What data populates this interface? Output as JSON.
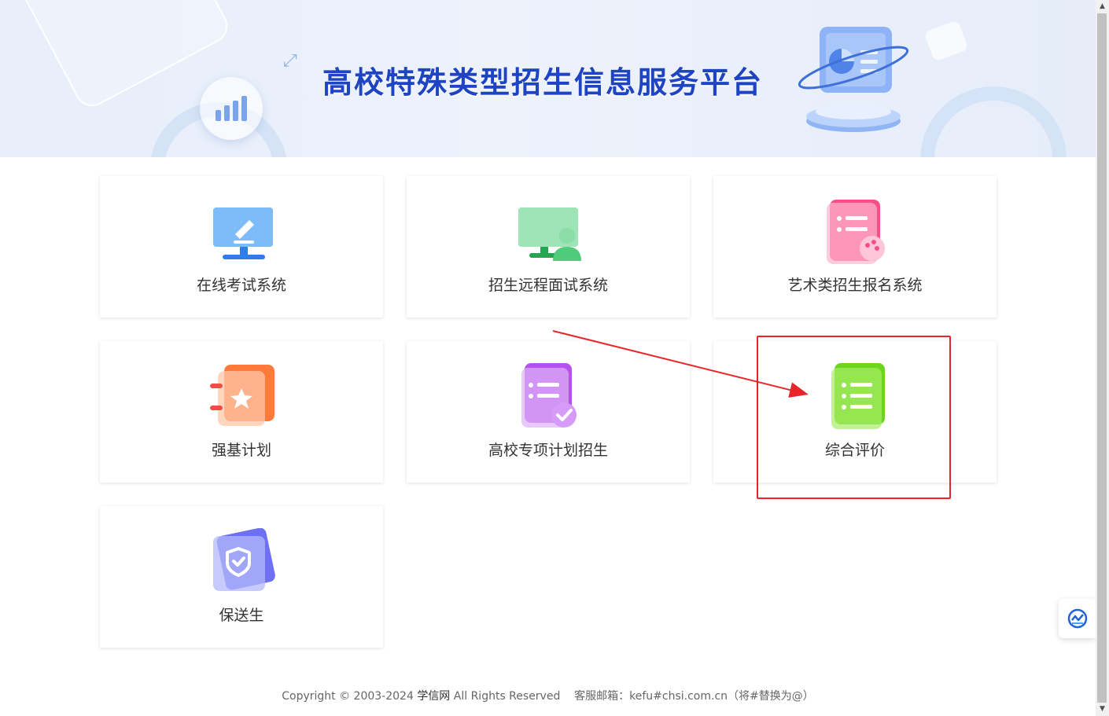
{
  "banner": {
    "title": "高校特殊类型招生信息服务平台",
    "title_color": "#1e44c4"
  },
  "cards": [
    {
      "label": "在线考试系统",
      "icon": "monitor-edit-icon",
      "color": "#4a9cf5"
    },
    {
      "label": "招生远程面试系统",
      "icon": "monitor-user-icon",
      "color": "#3dc46b"
    },
    {
      "label": "艺术类招生报名系统",
      "icon": "doc-palette-icon",
      "color": "#f7588d"
    },
    {
      "label": "强基计划",
      "icon": "notebook-star-icon",
      "color": "#fb7a3c"
    },
    {
      "label": "高校专项计划招生",
      "icon": "doc-check-icon",
      "color": "#b257ee"
    },
    {
      "label": "综合评价",
      "icon": "doc-list-icon",
      "color": "#6bd61c"
    },
    {
      "label": "保送生",
      "icon": "shield-check-icon",
      "color": "#6b73f3"
    }
  ],
  "annotation": {
    "highlight_color": "#e8262a",
    "target": "综合评价"
  },
  "footer": {
    "copyright_prefix": "Copyright © 2003-2024",
    "site_name": "学信网",
    "rights": "All Rights Reserved",
    "service_label": "客服邮箱：kefu#chsi.com.cn（将#替换为@）"
  },
  "float_widget": {
    "icon": "chat-logo-icon"
  }
}
